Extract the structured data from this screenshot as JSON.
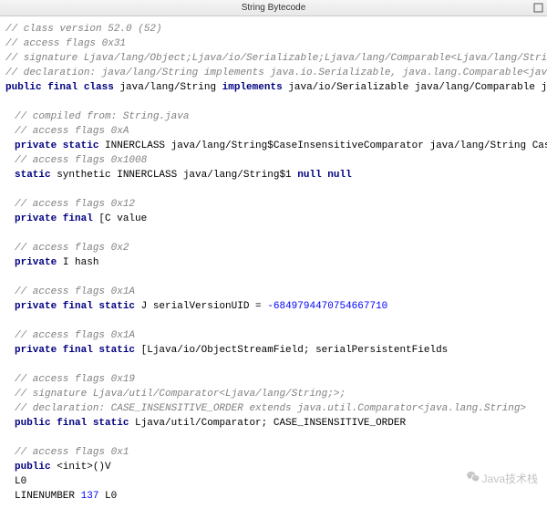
{
  "window": {
    "title": "String Bytecode"
  },
  "watermark": {
    "text": "Java技术栈"
  },
  "code": {
    "l1": "// class version 52.0 (52)",
    "l2": "// access flags 0x31",
    "l3": "// signature Ljava/lang/Object;Ljava/io/Serializable;Ljava/lang/Comparable<Ljava/lang/String;>;Ljav",
    "l4": "// declaration: java/lang/String implements java.io.Serializable, java.lang.Comparable<java.lang.St",
    "l5a": "public final class",
    "l5b": " java/lang/String ",
    "l5c": "implements",
    "l5d": " java/io/Serializable java/lang/Comparable java/lang/",
    "l6": "// compiled from: String.java",
    "l7": "// access flags 0xA",
    "l8a": "private static",
    "l8b": " INNERCLASS java/lang/String$CaseInsensitiveComparator java/lang/String CaseInsensi",
    "l9": "// access flags 0x1008",
    "l10a": "static",
    "l10b": " synthetic INNERCLASS java/lang/String$1 ",
    "l10c": "null null",
    "l11": "// access flags 0x12",
    "l12a": "private final",
    "l12b": " [C value",
    "l13": "// access flags 0x2",
    "l14a": "private",
    "l14b": " I hash",
    "l15": "// access flags 0x1A",
    "l16a": "private final static",
    "l16b": " J serialVersionUID = ",
    "l16c": "-6849794470754667710",
    "l17": "// access flags 0x1A",
    "l18a": "private final static",
    "l18b": " [Ljava/io/ObjectStreamField; serialPersistentFields",
    "l19": "// access flags 0x19",
    "l20": "// signature Ljava/util/Comparator<Ljava/lang/String;>;",
    "l21": "// declaration: CASE_INSENSITIVE_ORDER extends java.util.Comparator<java.lang.String>",
    "l22a": "public final static",
    "l22b": " Ljava/util/Comparator; CASE_INSENSITIVE_ORDER",
    "l23": "// access flags 0x1",
    "l24a": "public",
    "l24b": " <init>()V",
    "l25": " L0",
    "l26a": "  LINENUMBER ",
    "l26b": "137",
    "l26c": " L0"
  }
}
